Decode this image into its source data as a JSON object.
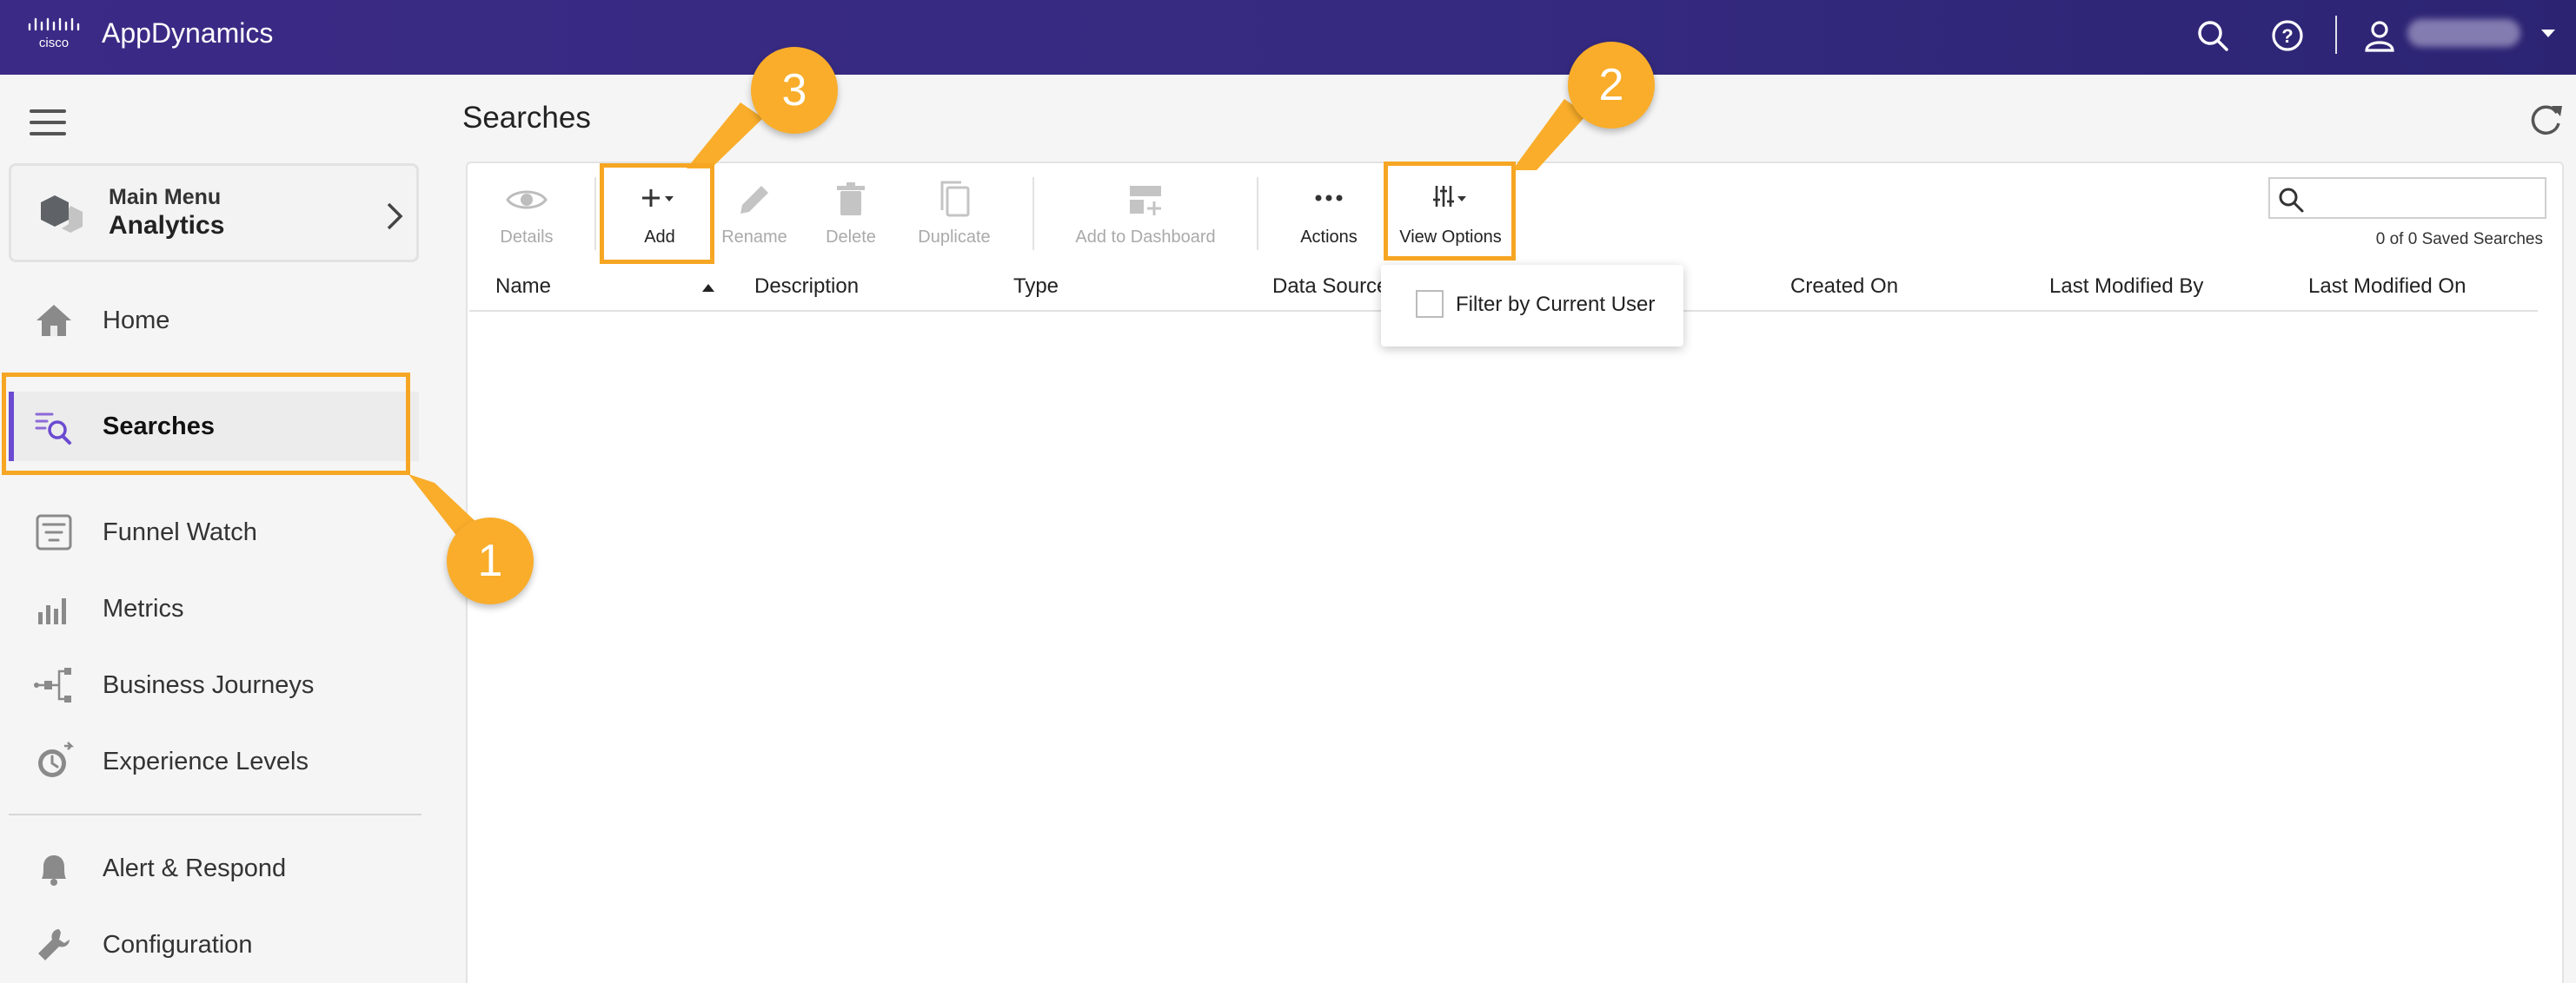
{
  "app": {
    "title": "AppDynamics",
    "user_name": ""
  },
  "sidebar": {
    "main_menu": {
      "label": "Main Menu",
      "title": "Analytics"
    },
    "items": [
      {
        "label": "Home",
        "icon": "home-icon"
      },
      {
        "label": "Searches",
        "icon": "search-list-icon",
        "active": true
      },
      {
        "label": "Funnel Watch",
        "icon": "funnel-watch-icon"
      },
      {
        "label": "Metrics",
        "icon": "bar-chart-icon"
      },
      {
        "label": "Business Journeys",
        "icon": "journey-icon"
      },
      {
        "label": "Experience Levels",
        "icon": "clock-icon"
      },
      {
        "label": "Alert & Respond",
        "icon": "bell-icon"
      },
      {
        "label": "Configuration",
        "icon": "wrench-icon"
      }
    ],
    "accent_color": "#6a4bd1"
  },
  "page": {
    "title": "Searches"
  },
  "toolbar": {
    "details": "Details",
    "add": "Add",
    "rename": "Rename",
    "delete": "Delete",
    "duplicate": "Duplicate",
    "add_to_dashboard": "Add to Dashboard",
    "actions": "Actions",
    "view_options": "View Options"
  },
  "search": {
    "placeholder": "",
    "value": "",
    "count_text": "0 of 0 Saved Searches"
  },
  "table": {
    "columns": [
      "Name",
      "Description",
      "Type",
      "Data Source",
      "Created On",
      "Last Modified By",
      "Last Modified On"
    ],
    "rows": []
  },
  "view_options_menu": {
    "filter_label": "Filter by Current User",
    "checked": false
  },
  "annotations": {
    "callouts": [
      "1",
      "2",
      "3"
    ],
    "highlight_color": "#f6a623"
  }
}
